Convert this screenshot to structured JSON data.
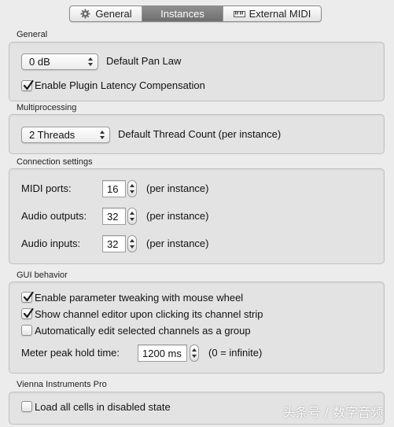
{
  "tabs": [
    {
      "label": "General",
      "icon": "gear-icon",
      "active": false
    },
    {
      "label": "Instances",
      "icon": "",
      "active": true
    },
    {
      "label": "External MIDI",
      "icon": "midi-keyboard-icon",
      "active": false
    }
  ],
  "general": {
    "title": "General",
    "pan_law_value": "0 dB",
    "pan_law_label": "Default Pan Law",
    "latency_label": "Enable Plugin Latency Compensation",
    "latency_checked": true
  },
  "multiprocessing": {
    "title": "Multiprocessing",
    "threads_value": "2 Threads",
    "threads_label": "Default Thread Count (per instance)"
  },
  "connection": {
    "title": "Connection settings",
    "midi_ports_label": "MIDI ports:",
    "midi_ports_value": "16",
    "audio_outputs_label": "Audio outputs:",
    "audio_outputs_value": "32",
    "audio_inputs_label": "Audio inputs:",
    "audio_inputs_value": "32",
    "per_instance": "(per instance)"
  },
  "gui": {
    "title": "GUI behavior",
    "tweak_label": "Enable parameter tweaking with mouse wheel",
    "tweak_checked": true,
    "show_editor_label": "Show channel editor upon clicking its channel strip",
    "show_editor_checked": true,
    "auto_edit_label": "Automatically edit selected channels as a group",
    "auto_edit_checked": false,
    "meter_label": "Meter peak hold time:",
    "meter_value": "1200 ms",
    "meter_hint": "(0 = infinite)"
  },
  "vienna": {
    "title": "Vienna Instruments Pro",
    "load_cells_label": "Load all cells in disabled state",
    "load_cells_checked": false
  },
  "watermark": "头条号 / 数字音频"
}
